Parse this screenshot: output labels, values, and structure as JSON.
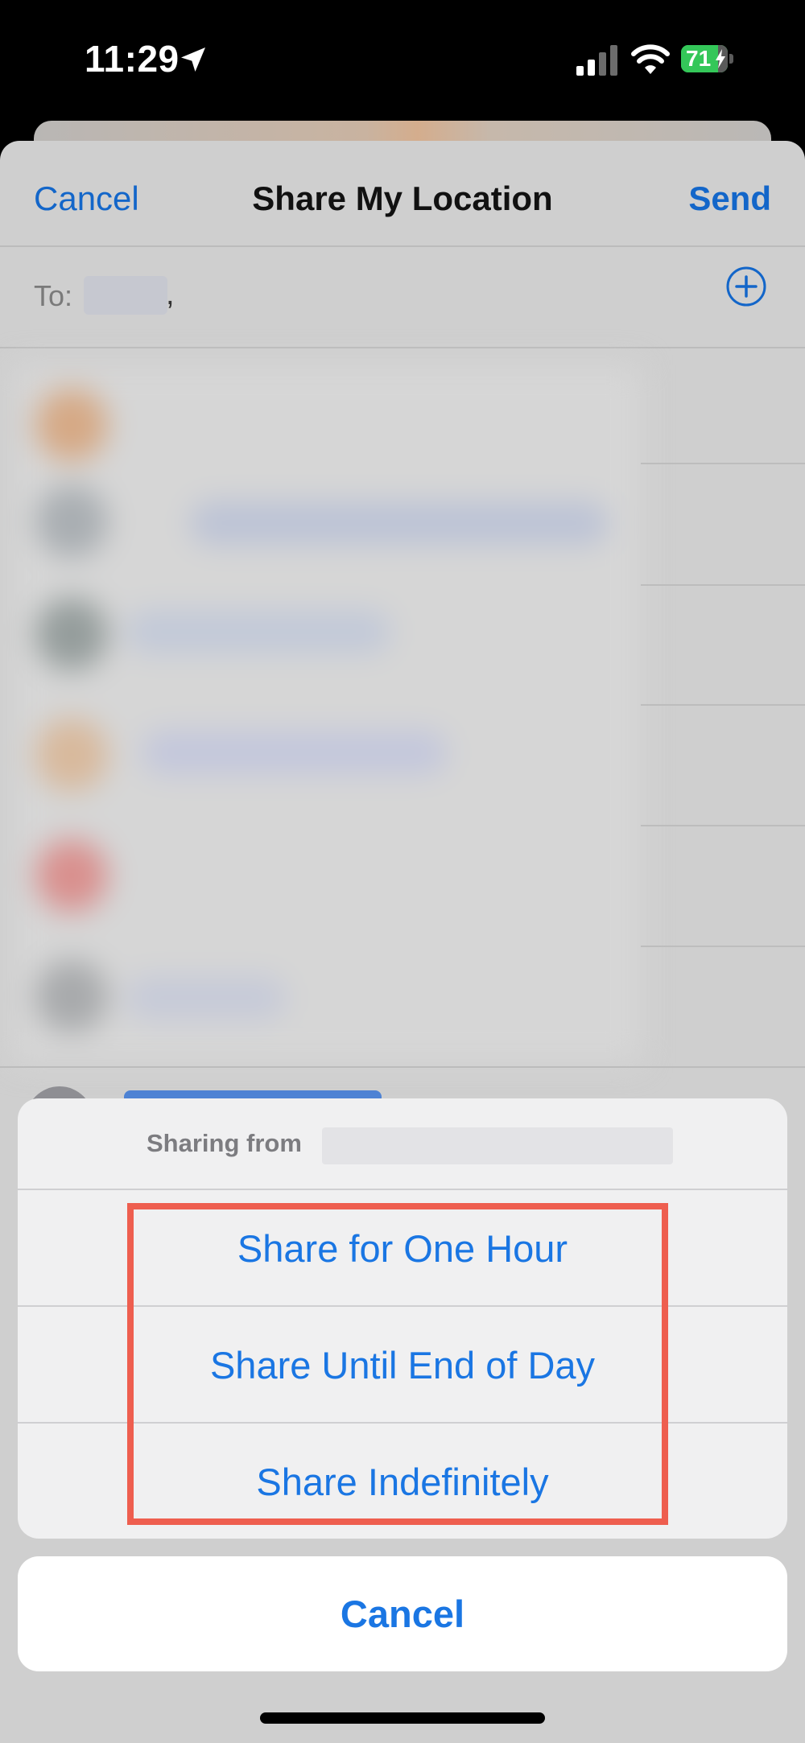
{
  "status_bar": {
    "time": "11:29",
    "battery_percent": "71",
    "icons": [
      "location-arrow-icon",
      "cellular-signal-icon",
      "wifi-icon",
      "battery-charging-icon"
    ]
  },
  "nav": {
    "cancel_label": "Cancel",
    "title": "Share My Location",
    "send_label": "Send"
  },
  "to_row": {
    "label": "To:",
    "separator": ",",
    "add_icon": "plus-circle-icon"
  },
  "action_sheet": {
    "header_label": "Sharing from",
    "options": [
      "Share for One Hour",
      "Share Until End of Day",
      "Share Indefinitely"
    ],
    "cancel_label": "Cancel"
  },
  "colors": {
    "accent": "#1a76e3",
    "highlight": "#ee5e4f",
    "battery": "#34c759"
  }
}
